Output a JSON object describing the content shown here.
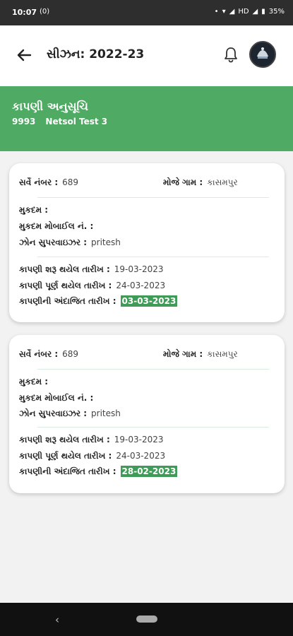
{
  "status_bar": {
    "time": "10:07",
    "notification": "(0)",
    "network": "HD",
    "battery": "35%"
  },
  "app_bar": {
    "title": "સીઝન: 2022-23"
  },
  "banner": {
    "title": "કાપણી અનુસૂચિ",
    "code": "9993",
    "name": "Netsol Test 3"
  },
  "cards": [
    {
      "survey_label": "સર્વે નંબર :",
      "survey_value": "689",
      "village_label": "મોજે ગામ :",
      "village_value": "કાસમપુર",
      "mukadam_label": "મુકદમ :",
      "mukadam_mobile_label": "મુકદમ મોબાઈલ નં. :",
      "zone_label": "ઝોન સુપરવાઇઝર :",
      "zone_value": "pritesh",
      "start_label": "કાપણી શરૂ થયેલ તારીખ :",
      "start_value": "19-03-2023",
      "complete_label": "કાપણી પૂર્ણ થયેલ તારીખ :",
      "complete_value": "24-03-2023",
      "estimated_label": "કાપણીની અંદાજિત તારીખ :",
      "estimated_value": "03-03-2023"
    },
    {
      "survey_label": "સર્વે નંબર :",
      "survey_value": "689",
      "village_label": "મોજે ગામ :",
      "village_value": "કાસમપુર",
      "mukadam_label": "મુકદમ :",
      "mukadam_mobile_label": "મુકદમ મોબાઈલ નં. :",
      "zone_label": "ઝોન સુપરવાઇઝર :",
      "zone_value": "pritesh",
      "start_label": "કાપણી શરૂ થયેલ તારીખ :",
      "start_value": "19-03-2023",
      "complete_label": "કાપણી પૂર્ણ થયેલ તારીખ :",
      "complete_value": "24-03-2023",
      "estimated_label": "કાપણીની અંદાજિત તારીખ :",
      "estimated_value": "28-02-2023"
    }
  ],
  "colors": {
    "accent_green": "#4faa63",
    "highlight_green": "#3f9b57"
  }
}
